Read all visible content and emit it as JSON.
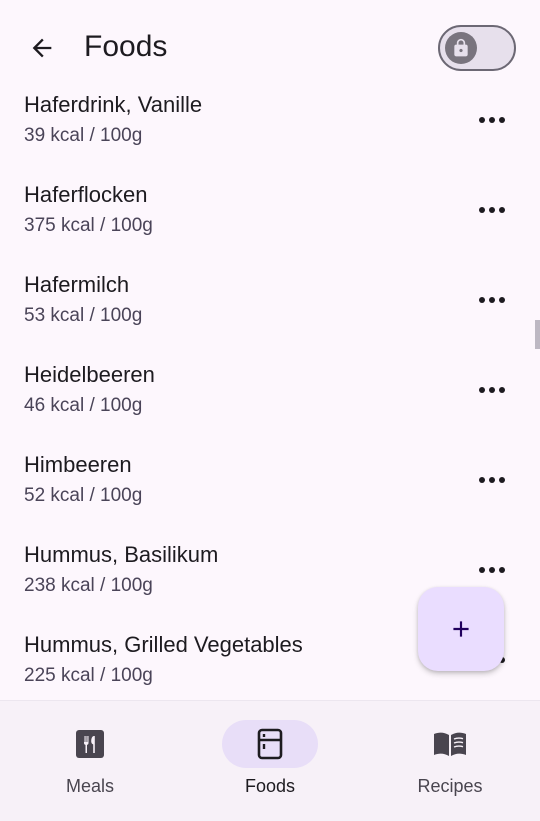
{
  "header": {
    "title": "Foods",
    "back_icon": "arrow-left-icon",
    "lock_toggle": {
      "icon": "lock-icon",
      "state": "off"
    }
  },
  "foods": [
    {
      "name": "Haferdrink, Vanille",
      "kcal": "39 kcal / 100g"
    },
    {
      "name": "Haferflocken",
      "kcal": "375 kcal / 100g"
    },
    {
      "name": "Hafermilch",
      "kcal": "53 kcal / 100g"
    },
    {
      "name": "Heidelbeeren",
      "kcal": "46 kcal / 100g"
    },
    {
      "name": "Himbeeren",
      "kcal": "52 kcal / 100g"
    },
    {
      "name": "Hummus, Basilikum",
      "kcal": "238 kcal / 100g"
    },
    {
      "name": "Hummus, Grilled Vegetables",
      "kcal": "225 kcal / 100g"
    }
  ],
  "fab": {
    "icon": "plus-icon"
  },
  "bottom_nav": {
    "items": [
      {
        "label": "Meals",
        "icon": "restaurant-icon",
        "active": false
      },
      {
        "label": "Foods",
        "icon": "fridge-icon",
        "active": true
      },
      {
        "label": "Recipes",
        "icon": "book-icon",
        "active": false
      }
    ]
  },
  "colors": {
    "background": "#fdf7fd",
    "fab": "#eaddff",
    "nav_active_pill": "#e8def8",
    "text_primary": "#1d1b20",
    "text_secondary": "#4a4458"
  }
}
